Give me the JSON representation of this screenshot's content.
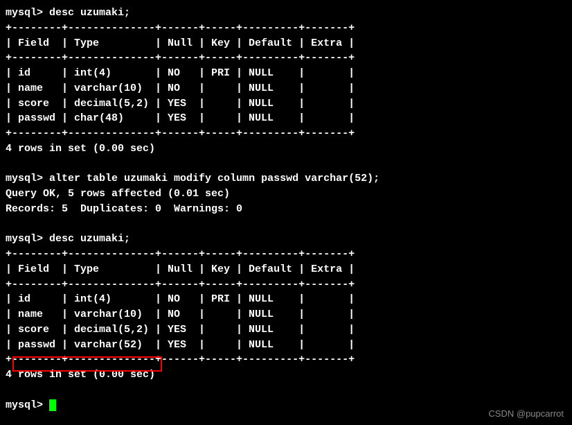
{
  "session": {
    "prompt": "mysql> ",
    "cmd1": "desc uzumaki;",
    "cmd2": "alter table uzumaki modify column passwd varchar(52);",
    "cmd3": "desc uzumaki;",
    "query_ok": "Query OK, 5 rows affected (0.01 sec)",
    "records": "Records: 5  Duplicates: 0  Warnings: 0",
    "result_footer": "4 rows in set (0.00 sec)"
  },
  "table1": {
    "border": "+--------+--------------+------+-----+---------+-------+",
    "header": "| Field  | Type         | Null | Key | Default | Extra |",
    "rows": [
      "| id     | int(4)       | NO   | PRI | NULL    |       |",
      "| name   | varchar(10)  | NO   |     | NULL    |       |",
      "| score  | decimal(5,2) | YES  |     | NULL    |       |",
      "| passwd | char(48)     | YES  |     | NULL    |       |"
    ]
  },
  "table2": {
    "border": "+--------+--------------+------+-----+---------+-------+",
    "header": "| Field  | Type         | Null | Key | Default | Extra |",
    "rows": [
      "| id     | int(4)       | NO   | PRI | NULL    |       |",
      "| name   | varchar(10)  | NO   |     | NULL    |       |",
      "| score  | decimal(5,2) | YES  |     | NULL    |       |",
      "| passwd | varchar(52)  | YES  |     | NULL    |       |"
    ]
  },
  "watermark": "CSDN @pupcarrot",
  "chart_data": {
    "type": "table",
    "tables": [
      {
        "title": "desc uzumaki (before)",
        "columns": [
          "Field",
          "Type",
          "Null",
          "Key",
          "Default",
          "Extra"
        ],
        "rows": [
          [
            "id",
            "int(4)",
            "NO",
            "PRI",
            "NULL",
            ""
          ],
          [
            "name",
            "varchar(10)",
            "NO",
            "",
            "NULL",
            ""
          ],
          [
            "score",
            "decimal(5,2)",
            "YES",
            "",
            "NULL",
            ""
          ],
          [
            "passwd",
            "char(48)",
            "YES",
            "",
            "NULL",
            ""
          ]
        ]
      },
      {
        "title": "desc uzumaki (after)",
        "columns": [
          "Field",
          "Type",
          "Null",
          "Key",
          "Default",
          "Extra"
        ],
        "rows": [
          [
            "id",
            "int(4)",
            "NO",
            "PRI",
            "NULL",
            ""
          ],
          [
            "name",
            "varchar(10)",
            "NO",
            "",
            "NULL",
            ""
          ],
          [
            "score",
            "decimal(5,2)",
            "YES",
            "",
            "NULL",
            ""
          ],
          [
            "passwd",
            "varchar(52)",
            "YES",
            "",
            "NULL",
            ""
          ]
        ]
      }
    ]
  }
}
